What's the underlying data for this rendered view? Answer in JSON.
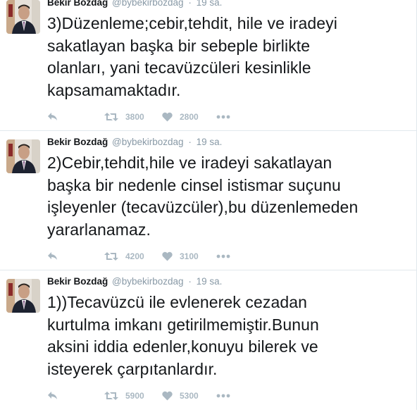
{
  "tweets": [
    {
      "name": "Bekir Bozdağ",
      "handle": "@bybekirbozdag",
      "separator": "·",
      "time": "19 sa.",
      "text": "3)Düzenleme;cebir,tehdit, hile ve iradeyi\nsakatlayan başka bir sebeple birlikte\nolanları, yani tecavüzcüleri kesinlikle\nkapsamamaktadır.",
      "retweets": "3800",
      "likes": "2800"
    },
    {
      "name": "Bekir Bozdağ",
      "handle": "@bybekirbozdag",
      "separator": "·",
      "time": "19 sa.",
      "text": "2)Cebir,tehdit,hile ve iradeyi sakatlayan\nbaşka bir nedenle cinsel istismar suçunu\nişleyenler (tecavüzcüler),bu düzenlemeden\nyararlanamaz.",
      "retweets": "4200",
      "likes": "3100"
    },
    {
      "name": "Bekir Bozdağ",
      "handle": "@bybekirbozdag",
      "separator": "·",
      "time": "19 sa.",
      "text": "1))Tecavüzcü ile evlenerek cezadan\nkurtulma imkanı getirilmemiştir.Bunun\naksini iddia edenler,konuyu bilerek ve\nisteyerek çarpıtanlardır.",
      "retweets": "5900",
      "likes": "5300"
    }
  ],
  "icons": {
    "reply": "reply-icon",
    "retweet": "retweet-icon",
    "like": "heart-icon",
    "more": "more-icon"
  },
  "colors": {
    "icon": "#aab8c2",
    "secondary_text": "#8899a6",
    "divider": "#e1e8ed"
  }
}
